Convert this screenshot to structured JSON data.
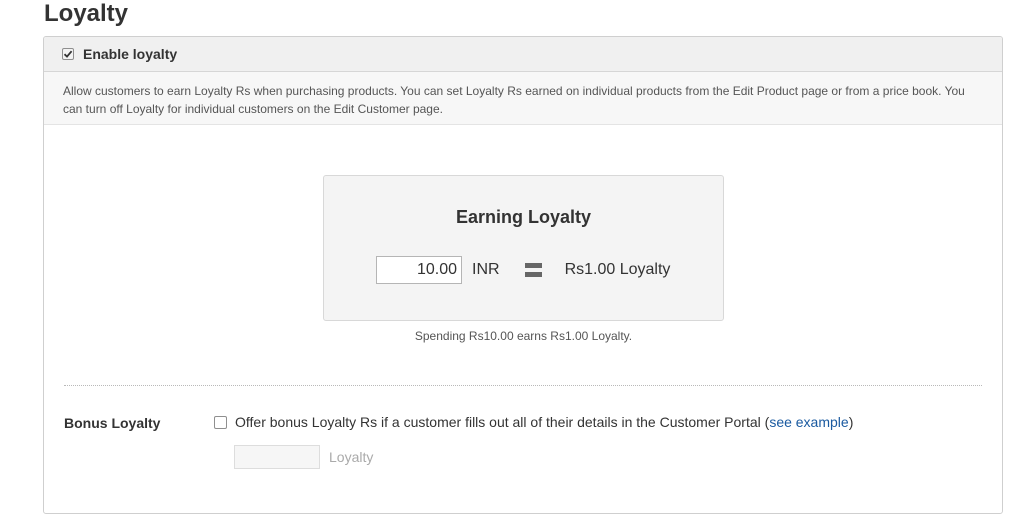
{
  "page": {
    "title": "Loyalty"
  },
  "enable": {
    "label": "Enable loyalty",
    "checked": true
  },
  "description": {
    "line1": "Allow customers to earn Loyalty Rs when purchasing products. You can set Loyalty Rs earned on individual products from the Edit Product page or from a price book. You",
    "line2": "can turn off Loyalty for individual customers on the Edit Customer page."
  },
  "earning": {
    "title": "Earning Loyalty",
    "amount_value": "10.00",
    "currency": "INR",
    "equals_icon": "equals-icon",
    "loyalty_value": "Rs1.00 Loyalty",
    "note": "Spending Rs10.00 earns Rs1.00 Loyalty."
  },
  "bonus": {
    "label": "Bonus Loyalty",
    "checked": false,
    "offer_text_pre": "Offer bonus Loyalty Rs if a customer fills out all of their details in the Customer Portal (",
    "see_example": "see example",
    "offer_text_post": ")",
    "amount_value": "",
    "unit": "Loyalty"
  },
  "colors": {
    "link": "#1a5aa0",
    "header_bg": "#f0f0f0",
    "box_bg": "#f4f4f4"
  }
}
